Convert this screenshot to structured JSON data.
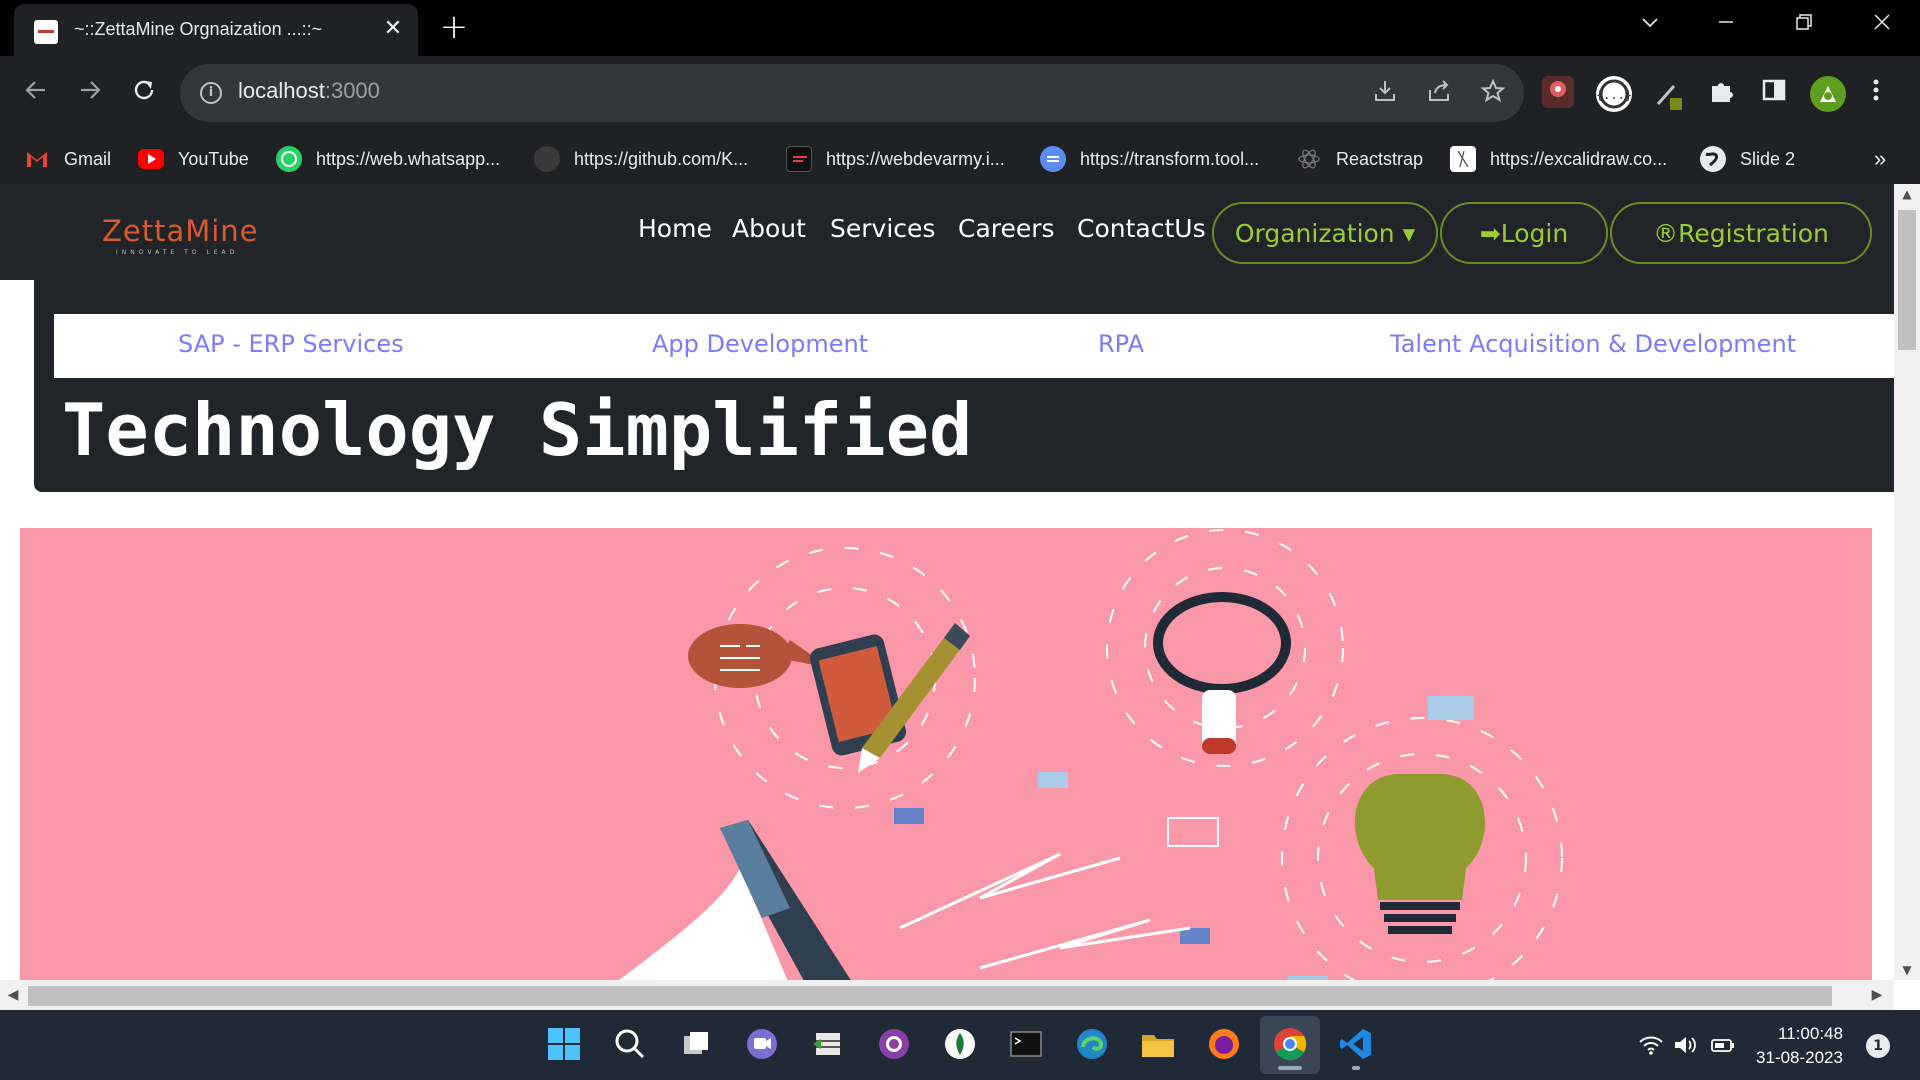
{
  "browser": {
    "tab_title": "~::ZettaMine Orgnaization ...::~",
    "tab_close": "✕",
    "new_tab": "+",
    "url_host": "localhost",
    "url_port": ":3000",
    "bookmarks": [
      {
        "label": "Gmail",
        "icon": "gmail-icon"
      },
      {
        "label": "YouTube",
        "icon": "youtube-icon"
      },
      {
        "label": "https://web.whatsapp...",
        "icon": "whatsapp-icon"
      },
      {
        "label": "https://github.com/K...",
        "icon": "github-icon"
      },
      {
        "label": "https://webdevarmy.i...",
        "icon": "webdevarmy-icon"
      },
      {
        "label": "https://transform.tool...",
        "icon": "transform-icon"
      },
      {
        "label": "Reactstrap",
        "icon": "react-icon"
      },
      {
        "label": "https://excalidraw.co...",
        "icon": "excalidraw-icon"
      },
      {
        "label": "Slide 2",
        "icon": "globe-icon"
      }
    ],
    "bookmarks_overflow": "»"
  },
  "site": {
    "logo_text": "ZettaMine",
    "logo_tagline": "INNOVATE TO LEAD",
    "nav": {
      "home": "Home",
      "about": "About",
      "services": "Services",
      "careers": "Careers",
      "contact": "ContactUs",
      "organization": "Organization ▾",
      "login": "➡Login",
      "registration": "®Registration"
    },
    "services": {
      "sap": "SAP - ERP Services",
      "app": "App Development",
      "rpa": "RPA",
      "talent": "Talent Acquisition & Development"
    },
    "hero_title": "Technology Simplified"
  },
  "taskbar": {
    "time": "11:00:48",
    "date": "31-08-2023",
    "notifications": "1"
  },
  "colors": {
    "nav_bg": "#212529",
    "accent_green": "#9acd32",
    "service_link": "#7b7bff",
    "banner_pink": "#fa97a8",
    "logo_orange": "#d95a2b"
  }
}
